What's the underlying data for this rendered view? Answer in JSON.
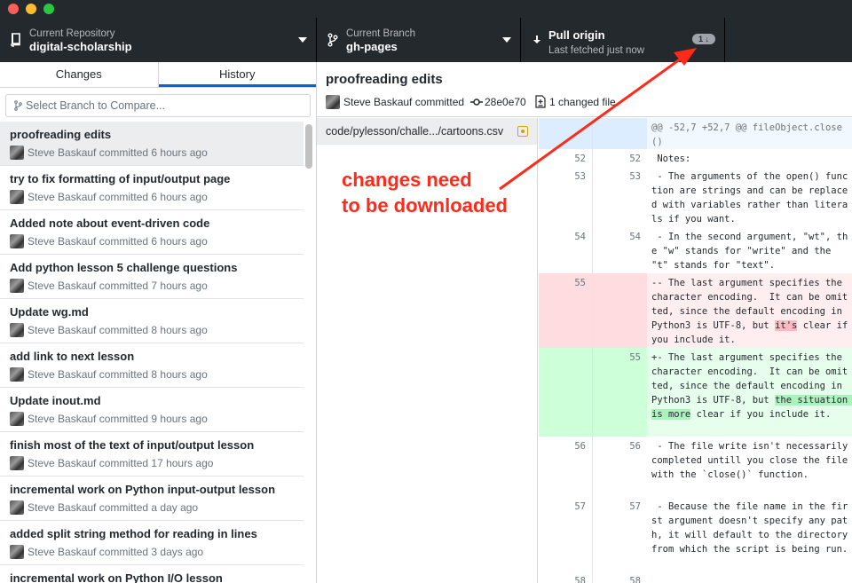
{
  "window": {
    "traffic_lights": [
      "close",
      "minimize",
      "zoom"
    ]
  },
  "toolbar": {
    "repository": {
      "label": "Current Repository",
      "value": "digital-scholarship",
      "icon": "repo-icon"
    },
    "branch": {
      "label": "Current Branch",
      "value": "gh-pages",
      "icon": "branch-icon"
    },
    "pull": {
      "title": "Pull origin",
      "subtitle": "Last fetched just now",
      "badge": "1",
      "icon": "arrow-down-icon"
    }
  },
  "sidebar": {
    "tabs": [
      {
        "label": "Changes",
        "selected": false
      },
      {
        "label": "History",
        "selected": true
      }
    ],
    "compare_placeholder": "Select Branch to Compare...",
    "commits": [
      {
        "title": "proofreading edits",
        "meta": "Steve Baskauf committed 6 hours ago",
        "selected": true
      },
      {
        "title": "try to fix formatting of input/output page",
        "meta": "Steve Baskauf committed 6 hours ago"
      },
      {
        "title": "Added note about event-driven code",
        "meta": "Steve Baskauf committed 6 hours ago"
      },
      {
        "title": "Add python lesson 5 challenge questions",
        "meta": "Steve Baskauf committed 7 hours ago"
      },
      {
        "title": "Update wg.md",
        "meta": "Steve Baskauf committed 8 hours ago"
      },
      {
        "title": "add link to next lesson",
        "meta": "Steve Baskauf committed 8 hours ago"
      },
      {
        "title": "Update inout.md",
        "meta": "Steve Baskauf committed 9 hours ago"
      },
      {
        "title": "finish most of the text of input/output lesson",
        "meta": "Steve Baskauf committed 17 hours ago"
      },
      {
        "title": "incremental work on Python input-output lesson",
        "meta": "Steve Baskauf committed a day ago"
      },
      {
        "title": "added split string method for reading in lines",
        "meta": "Steve Baskauf committed 3 days ago"
      },
      {
        "title": "incremental work on Python I/O lesson",
        "meta": ""
      }
    ]
  },
  "commit_detail": {
    "title": "proofreading edits",
    "author": "Steve Baskauf committed",
    "sha": "28e0e70",
    "files_changed": "1 changed file",
    "file": {
      "path": "code/pylesson/challe.../cartoons.csv",
      "status": "modified"
    }
  },
  "diff": {
    "hunk": "@@ -52,7 +52,7 @@ fileObject.close()",
    "lines": [
      {
        "type": "ctx",
        "old": "52",
        "new": "52",
        "text": " Notes:"
      },
      {
        "type": "ctx",
        "old": "53",
        "new": "53",
        "text": " - The arguments of the open() function are strings and can be replaced with variables rather than literals if you want."
      },
      {
        "type": "ctx",
        "old": "54",
        "new": "54",
        "text": " - In the second argument, \"wt\", the \"w\" stands for \"write\" and the \"t\" stands for \"text\"."
      },
      {
        "type": "del",
        "old": "55",
        "new": "",
        "pre": "-- The last argument specifies the character encoding.  It can be omitted, since the default encoding in Python3 is UTF-8, but ",
        "hl": "it's",
        "post": " clear if you include it."
      },
      {
        "type": "add",
        "old": "",
        "new": "55",
        "pre": "+- The last argument specifies the character encoding.  It can be omitted, since the default encoding in Python3 is UTF-8, but ",
        "hl": "the situation is more",
        "post": " clear if you include it."
      },
      {
        "type": "ctx",
        "old": "56",
        "new": "56",
        "text": " - The file write isn't necessarily completed untill you close the file with the `close()` function."
      },
      {
        "type": "ctx",
        "old": "57",
        "new": "57",
        "text": " - Because the file name in the first argument doesn't specify any path, it will default to the directory from which the script is being run."
      },
      {
        "type": "ctx",
        "old": "58",
        "new": "58",
        "text": ""
      }
    ]
  },
  "annotation": {
    "text": "changes need\nto be downloaded",
    "color": "#ff2a1a"
  }
}
